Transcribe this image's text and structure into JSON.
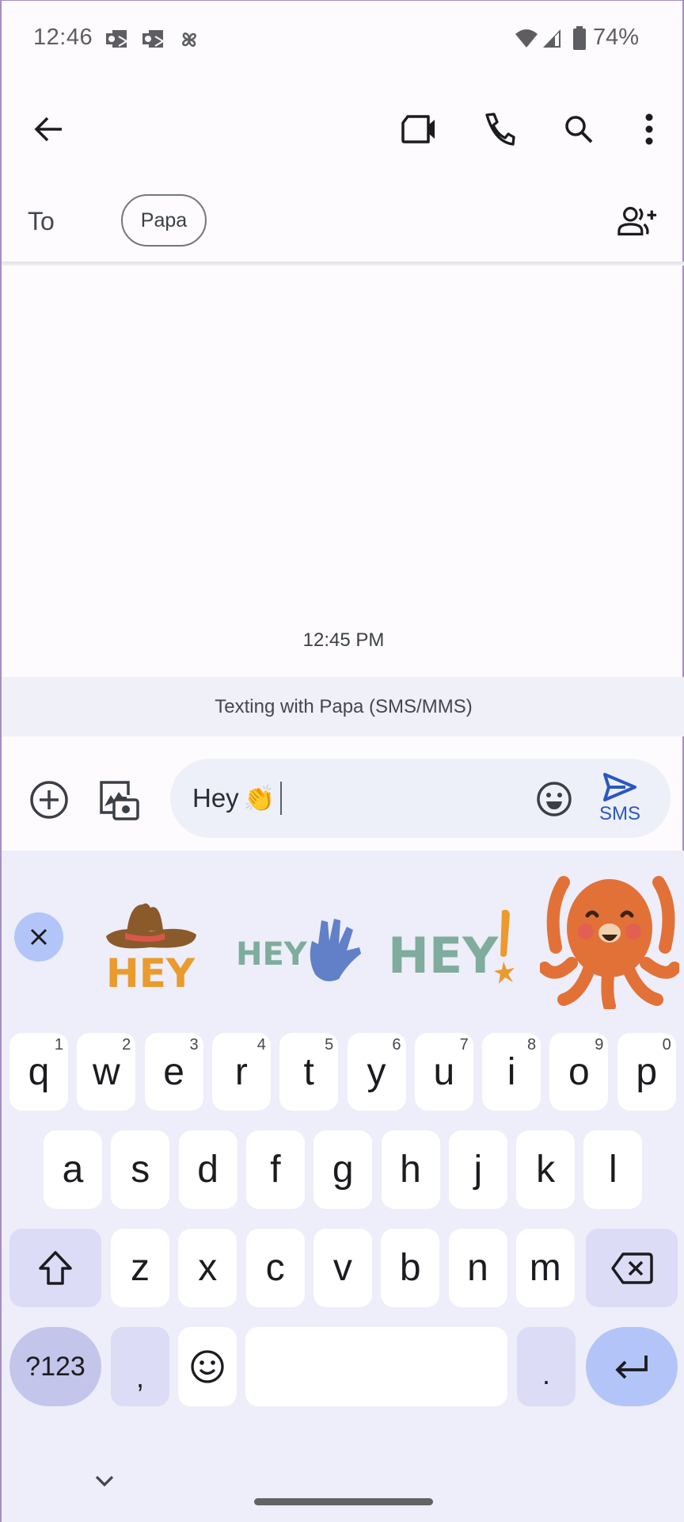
{
  "status_bar": {
    "time": "12:46",
    "notification_icons": [
      "outlook-icon",
      "outlook-icon",
      "pinwheel-icon"
    ],
    "system_icons": [
      "wifi-icon",
      "cell-signal-icon",
      "battery-icon"
    ],
    "battery": "74%"
  },
  "app_bar": {
    "back_icon": "arrow-back-icon",
    "actions": [
      "video-call-icon",
      "phone-icon",
      "search-icon",
      "more-vert-icon"
    ]
  },
  "recipients": {
    "to_label": "To",
    "chips": [
      "Papa"
    ],
    "add_icon": "add-person-icon"
  },
  "conversation": {
    "timestamp": "12:45 PM",
    "banner": "Texting with Papa (SMS/MMS)"
  },
  "compose": {
    "message_text": "Hey",
    "message_emoji": "👏",
    "send_label": "SMS",
    "accent": "#2a57c3"
  },
  "stickers": {
    "items": [
      "HEY cowboy hat sticker",
      "HEY waving hand sticker",
      "HEY! sticker",
      "Octopus waving sticker"
    ]
  },
  "keyboard": {
    "row1": [
      {
        "k": "q",
        "h": "1"
      },
      {
        "k": "w",
        "h": "2"
      },
      {
        "k": "e",
        "h": "3"
      },
      {
        "k": "r",
        "h": "4"
      },
      {
        "k": "t",
        "h": "5"
      },
      {
        "k": "y",
        "h": "6"
      },
      {
        "k": "u",
        "h": "7"
      },
      {
        "k": "i",
        "h": "8"
      },
      {
        "k": "o",
        "h": "9"
      },
      {
        "k": "p",
        "h": "0"
      }
    ],
    "row2": [
      "a",
      "s",
      "d",
      "f",
      "g",
      "h",
      "j",
      "k",
      "l"
    ],
    "row3": [
      "z",
      "x",
      "c",
      "v",
      "b",
      "n",
      "m"
    ],
    "symbols_label": "?123",
    "comma": ",",
    "period": "."
  }
}
